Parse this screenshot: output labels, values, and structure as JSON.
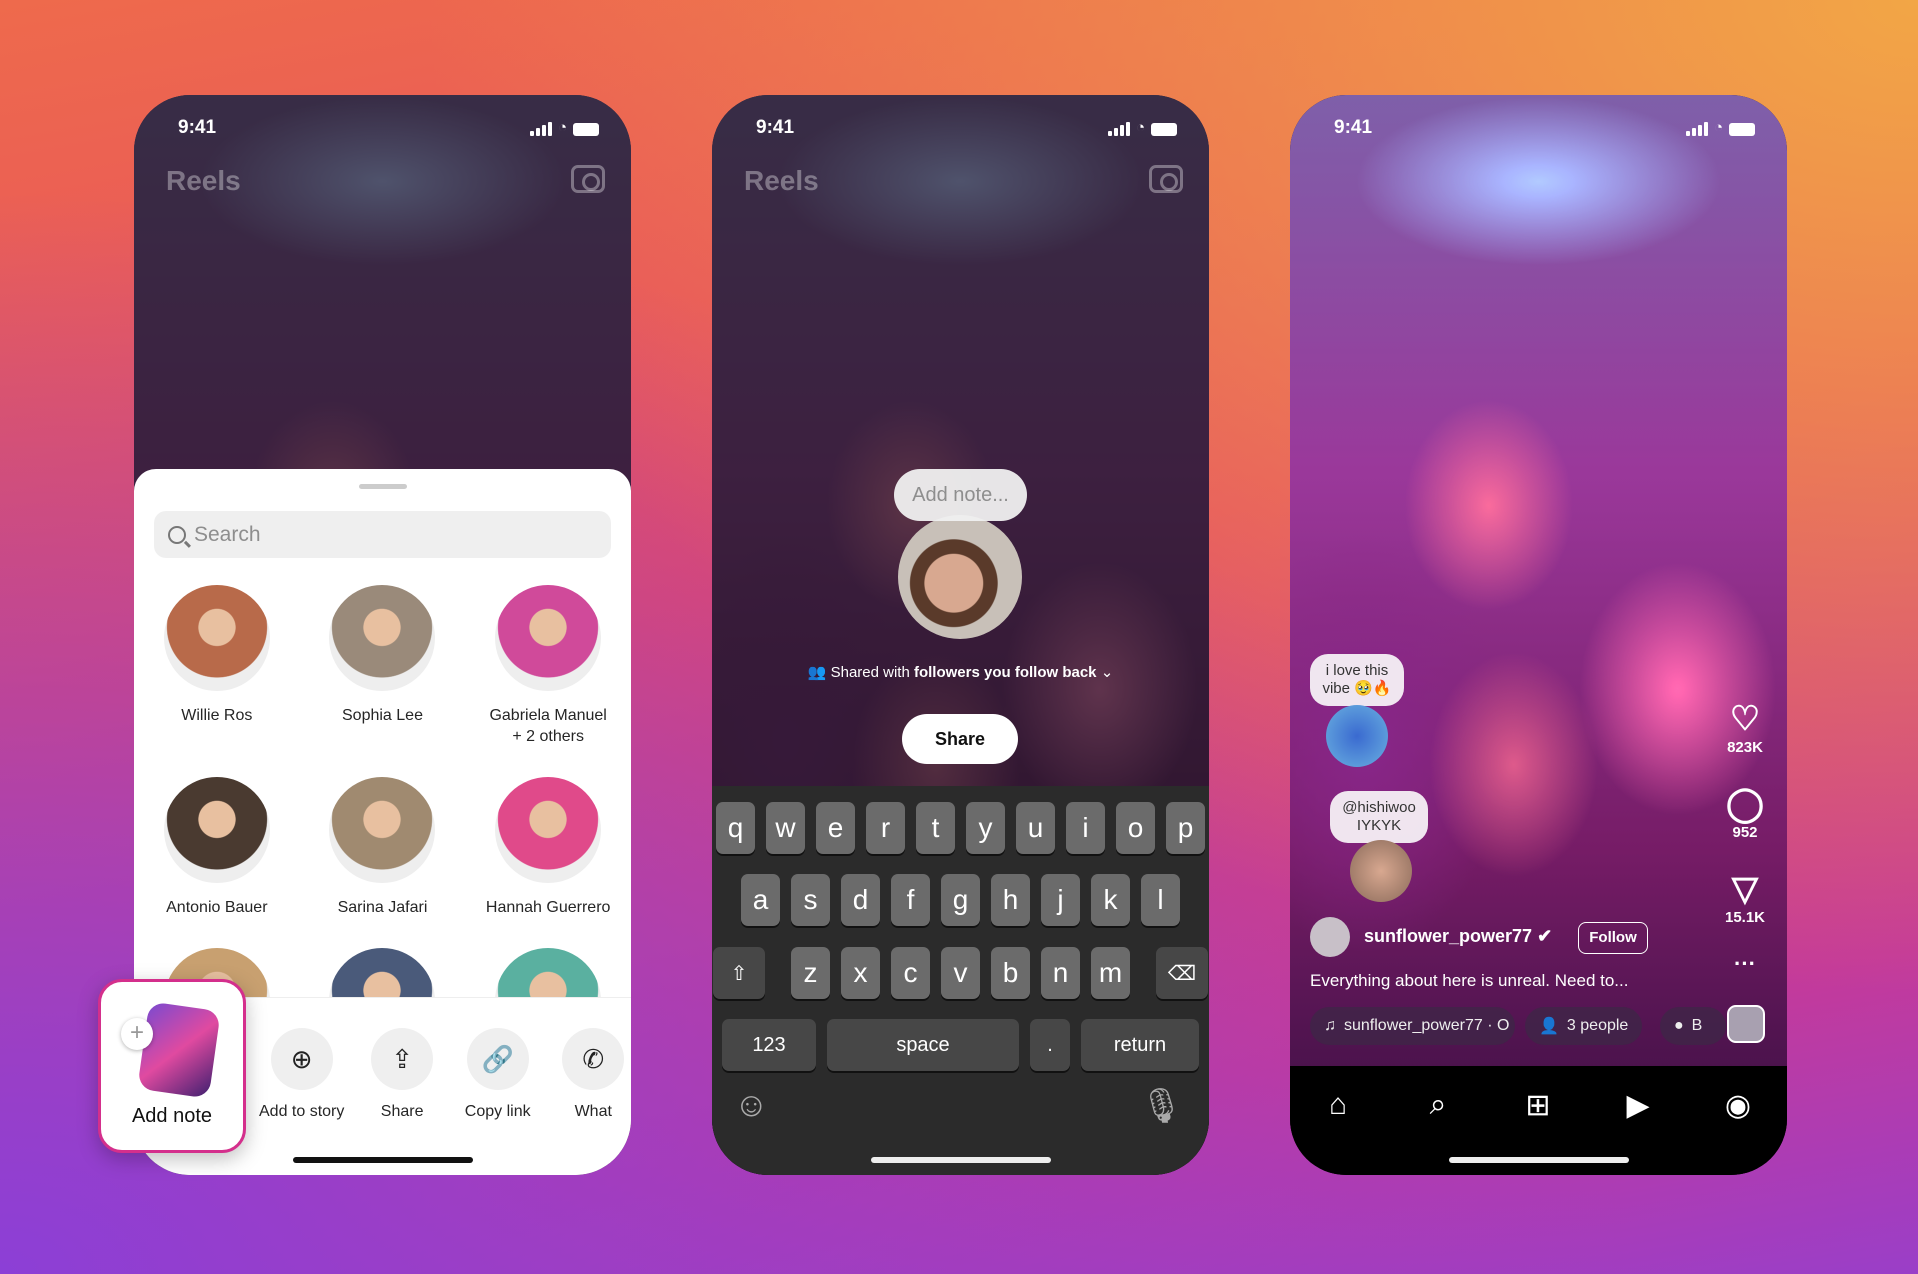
{
  "status": {
    "time": "9:41"
  },
  "phone1": {
    "title": "Reels",
    "search_placeholder": "Search",
    "people": [
      {
        "name": "Willie Ros",
        "color": "#b86a4a"
      },
      {
        "name": "Sophia Lee",
        "color": "#9a8a7a"
      },
      {
        "name": "Gabriela Manuel\n+ 2 others",
        "color": "#d04a9a"
      },
      {
        "name": "Antonio Bauer",
        "color": "#4a3a30"
      },
      {
        "name": "Sarina Jafari",
        "color": "#a08a70"
      },
      {
        "name": "Hannah Guerrero",
        "color": "#e04a8a"
      },
      {
        "name": "",
        "color": "#c8a070"
      },
      {
        "name": "",
        "color": "#4a5a7a"
      },
      {
        "name": "",
        "color": "#5ab0a0"
      }
    ],
    "actions": [
      {
        "label": "Add to story",
        "icon": "add-story-icon",
        "glyph": "⊕"
      },
      {
        "label": "Share",
        "icon": "share-icon",
        "glyph": "⇪"
      },
      {
        "label": "Copy link",
        "icon": "link-icon",
        "glyph": "🔗"
      },
      {
        "label": "What",
        "icon": "whatsapp-icon",
        "glyph": "✆"
      }
    ],
    "add_note": "Add note"
  },
  "phone2": {
    "title": "Reels",
    "note_placeholder": "Add note...",
    "shared_prefix": "Shared with",
    "shared_audience": "followers you follow back",
    "share_button": "Share",
    "keyboard": {
      "row1": [
        "q",
        "w",
        "e",
        "r",
        "t",
        "y",
        "u",
        "i",
        "o",
        "p"
      ],
      "row2": [
        "a",
        "s",
        "d",
        "f",
        "g",
        "h",
        "j",
        "k",
        "l"
      ],
      "row3": [
        "z",
        "x",
        "c",
        "v",
        "b",
        "n",
        "m"
      ],
      "numbers": "123",
      "space": "space",
      "period": ".",
      "return": "return"
    }
  },
  "phone3": {
    "notes": [
      {
        "text": "i love this vibe 🥹🔥"
      },
      {
        "text": "@hishiwoo IYKYK"
      }
    ],
    "username": "sunflower_power77",
    "follow": "Follow",
    "caption": "Everything about here is unreal. Need to...",
    "likes": "823K",
    "comments": "952",
    "shares": "15.1K",
    "chips": {
      "audio": "sunflower_power77 · O",
      "people": "3 people",
      "location": "B"
    },
    "nav": [
      "home-icon",
      "search-icon",
      "create-icon",
      "reels-icon",
      "profile-icon"
    ]
  },
  "colors": {
    "accent": "#d42f8c"
  }
}
